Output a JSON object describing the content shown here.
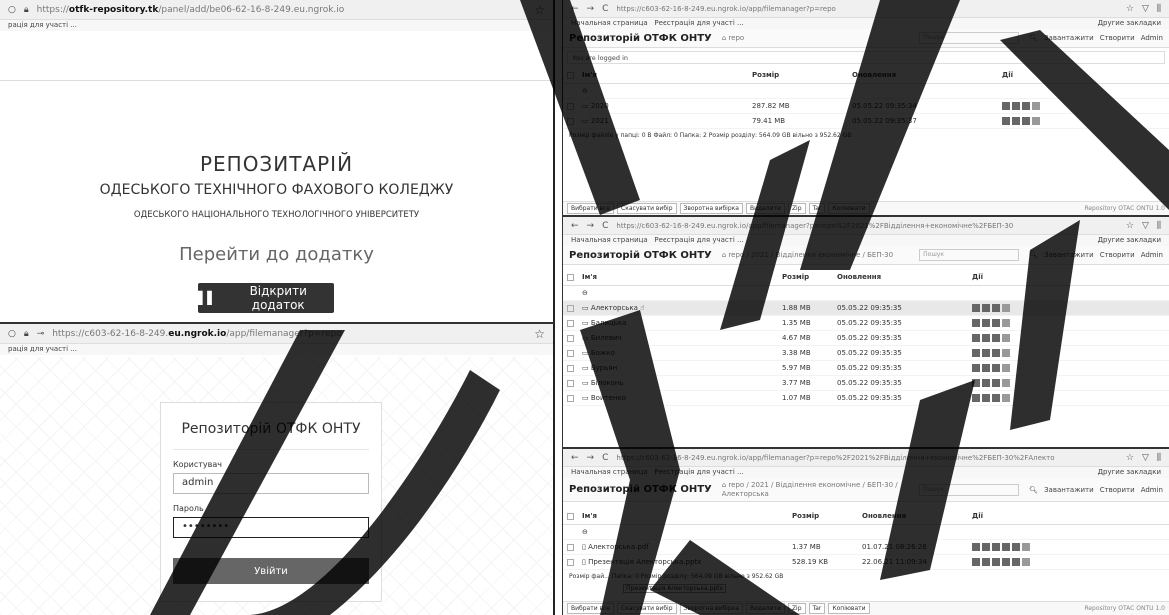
{
  "p1": {
    "url_pre": "https://",
    "url_bold": "otfk-repository.tk",
    "url_post": "/panel/add/be06-62-16-8-249.eu.ngrok.io",
    "bookmark": "рація для участі ...",
    "title": "РЕПОЗИТАРІЙ",
    "subtitle": "ОДЕСЬКОГО ТЕХНІЧНОГО ФАХОВОГО КОЛЕДЖУ",
    "subtitle2": "ОДЕСЬКОГО НАЦІОНАЛЬНОГО ТЕХНОЛОГІЧНОГО УНІВЕРСИТЕТУ",
    "goto": "Перейти до додатку",
    "open_btn": "Відкрити додаток"
  },
  "p2": {
    "url_pre": "https://c603-62-16-8-249.",
    "url_bold": "eu.ngrok.io",
    "url_post": "/app/filemanager?p=repo",
    "bookmark": "рація для участі ...",
    "login_title": "Репозиторій ОТФК ОНТУ",
    "user_label": "Користувач",
    "user_value": "admin",
    "pass_label": "Пароль",
    "pass_value": "••••••••",
    "submit": "Увійти"
  },
  "app": {
    "brand": "Репозиторій ОТФК ОНТУ",
    "search_placeholder": "Пошук",
    "upload": "Завантажити",
    "create": "Створити",
    "admin": "Admin",
    "bm1": "Начальная страница",
    "bm2": "Реєстрація для участі ...",
    "bm_other": "Другие закладки",
    "col_name": "Ім'я",
    "col_size": "Розмір",
    "col_updated": "Оновлення",
    "col_actions": "Дії",
    "version": "Repository OTAC ONTU 1.0",
    "btn_select_all": "Вибрати все",
    "btn_cancel": "Скасувати вибір",
    "btn_invert": "Зворотна вибірка",
    "btn_delete": "Видалити",
    "btn_zip": "Zip",
    "btn_tar": "Tar",
    "btn_copy": "Копіювати"
  },
  "p3": {
    "url": "https://c603-62-16-8-249.eu.ngrok.io/app/filemanager?p=repo",
    "crumb": "repo",
    "message": "You are logged in",
    "rows": [
      {
        "name": "2020",
        "size": "287.82 MB",
        "date": "05.05.22 09:35:34"
      },
      {
        "name": "2021",
        "size": "79.41 MB",
        "date": "05.05.22 09:35:37"
      }
    ],
    "summary": "Розмір файлів у папці: 0 B  Файл: 0  Папка: 2  Розмір розділу: 564.09 GB вільно з 952.62 GB"
  },
  "p4": {
    "url": "https://c603-62-16-8-249.eu.ngrok.io/app/filemanager?p=repo%2F2021%2FВідділення+економічне%2FБЕП-30",
    "crumb": "repo / 2021 / Відділення економічне / БЕП-30",
    "rows": [
      {
        "name": "Алекторська",
        "size": "1.88 MB",
        "date": "05.05.22 09:35:35"
      },
      {
        "name": "Балицька",
        "size": "1.35 MB",
        "date": "05.05.22 09:35:35"
      },
      {
        "name": "Билевич",
        "size": "4.67 MB",
        "date": "05.05.22 09:35:35"
      },
      {
        "name": "Божко",
        "size": "3.38 MB",
        "date": "05.05.22 09:35:35"
      },
      {
        "name": "Бурьян",
        "size": "5.97 MB",
        "date": "05.05.22 09:35:35"
      },
      {
        "name": "Білоконь",
        "size": "3.77 MB",
        "date": "05.05.22 09:35:35"
      },
      {
        "name": "Войтенко",
        "size": "1.07 MB",
        "date": "05.05.22 09:35:35"
      }
    ]
  },
  "p5": {
    "url": "https://c603-62-16-8-249.eu.ngrok.io/app/filemanager?p=repo%2F2021%2FВідділення+економічне%2FБЕП-30%2FАлекто",
    "crumb": "repo / 2021 / Відділення економічне / БЕП-30 / Алекторська",
    "rows": [
      {
        "name": "Алекторська.pdf",
        "size": "1.37 MB",
        "date": "01.07.21 08:26:26"
      },
      {
        "name": "Презентація Алекторська.pptx",
        "size": "528.19 KB",
        "date": "22.06.21 11:09:34"
      }
    ],
    "tooltip": "Презентація Алекторська.pptx",
    "summary": "Розмір фай...  Папка: 0  Розмір розділу: 564.09 GB вільно з 952.62 GB"
  },
  "watermark": {
    "text": "ОНТУ",
    "color": "#000000"
  }
}
